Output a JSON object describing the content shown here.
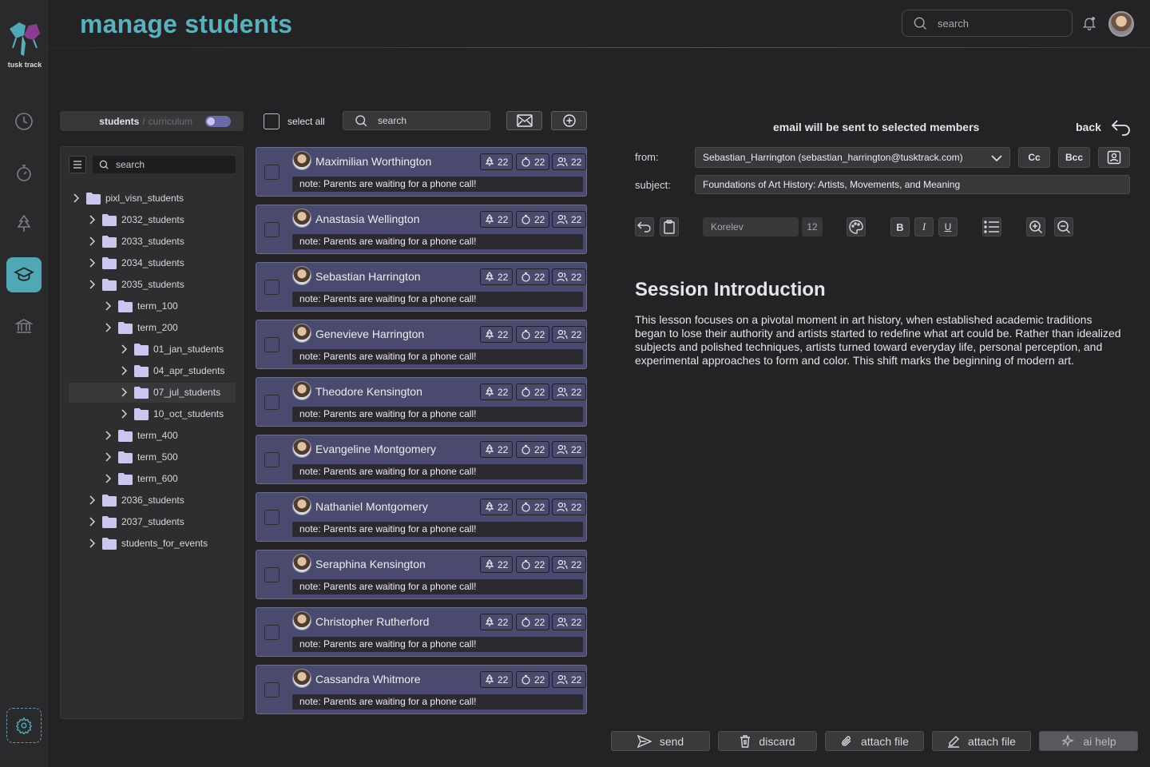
{
  "brand": {
    "logo_text": "tusk track"
  },
  "header": {
    "title": "manage students",
    "search_placeholder": "search"
  },
  "nav": [
    "clock-icon",
    "timer-icon",
    "tree-icon",
    "graduation-cap-icon",
    "institution-icon",
    "settings-icon"
  ],
  "tree": {
    "switch": {
      "active": "students",
      "separator": "/",
      "inactive": "curriculum"
    },
    "search_placeholder": "search",
    "items": [
      {
        "label": "pixl_visn_students",
        "depth": 0
      },
      {
        "label": "2032_students",
        "depth": 1
      },
      {
        "label": "2033_students",
        "depth": 1
      },
      {
        "label": "2034_students",
        "depth": 1
      },
      {
        "label": "2035_students",
        "depth": 1
      },
      {
        "label": "term_100",
        "depth": 2
      },
      {
        "label": "term_200",
        "depth": 2
      },
      {
        "label": "01_jan_students",
        "depth": 3
      },
      {
        "label": "04_apr_students",
        "depth": 3
      },
      {
        "label": "07_jul_students",
        "depth": 3,
        "selected": true
      },
      {
        "label": "10_oct_students",
        "depth": 3
      },
      {
        "label": "term_400",
        "depth": 2
      },
      {
        "label": "term_500",
        "depth": 2
      },
      {
        "label": "term_600",
        "depth": 2
      },
      {
        "label": "2036_students",
        "depth": 1
      },
      {
        "label": "2037_students",
        "depth": 1
      },
      {
        "label": "students_for_events",
        "depth": 1
      }
    ]
  },
  "list": {
    "select_all_label": "select all",
    "search_placeholder": "search",
    "students": [
      {
        "name": "Maximilian Worthington",
        "trees": "22",
        "timers": "22",
        "groups": "22",
        "note": "note: Parents are waiting for a phone call!"
      },
      {
        "name": "Anastasia Wellington",
        "trees": "22",
        "timers": "22",
        "groups": "22",
        "note": "note: Parents are waiting for a phone call!"
      },
      {
        "name": "Sebastian Harrington",
        "trees": "22",
        "timers": "22",
        "groups": "22",
        "note": "note: Parents are waiting for a phone call!"
      },
      {
        "name": "Genevieve Harrington",
        "trees": "22",
        "timers": "22",
        "groups": "22",
        "note": "note: Parents are waiting for a phone call!"
      },
      {
        "name": "Theodore Kensington",
        "trees": "22",
        "timers": "22",
        "groups": "22",
        "note": "note: Parents are waiting for a phone call!"
      },
      {
        "name": "Evangeline Montgomery",
        "trees": "22",
        "timers": "22",
        "groups": "22",
        "note": "note: Parents are waiting for a phone call!"
      },
      {
        "name": "Nathaniel Montgomery",
        "trees": "22",
        "timers": "22",
        "groups": "22",
        "note": "note: Parents are waiting for a phone call!"
      },
      {
        "name": "Seraphina Kensington",
        "trees": "22",
        "timers": "22",
        "groups": "22",
        "note": "note: Parents are waiting for a phone call!"
      },
      {
        "name": "Christopher Rutherford",
        "trees": "22",
        "timers": "22",
        "groups": "22",
        "note": "note: Parents are waiting for a phone call!"
      },
      {
        "name": "Cassandra Whitmore",
        "trees": "22",
        "timers": "22",
        "groups": "22",
        "note": "note: Parents are waiting for a phone call!"
      }
    ]
  },
  "email": {
    "heading": "email will be sent to selected members",
    "back_label": "back",
    "from_label": "from:",
    "from_value": "Sebastian_Harrington (sebastian_harrington@tusktrack.com)",
    "cc_label": "Cc",
    "bcc_label": "Bcc",
    "subject_label": "subject:",
    "subject_value": "Foundations of Art History: Artists, Movements, and Meaning",
    "toolbar": {
      "font": "Korelev",
      "size": "12",
      "bold": "B",
      "italic": "I",
      "underline": "U"
    },
    "doc_title": "Session Introduction",
    "doc_body": "This lesson focuses on a pivotal moment in art history, when established academic traditions began to lose their authority and artists started to redefine what art could be. Rather than idealized subjects and polished techniques, artists turned toward everyday life, personal perception, and experimental approaches to form and color. This shift marks the beginning of modern art.",
    "actions": {
      "send": "send",
      "discard": "discard",
      "attach1": "attach file",
      "attach2": "attach file",
      "ai": "ai help"
    }
  },
  "colors": {
    "accent": "#5bb0bb",
    "card": "#4a4a6e",
    "toggle": "#6b6aa8",
    "background": "#232325"
  }
}
